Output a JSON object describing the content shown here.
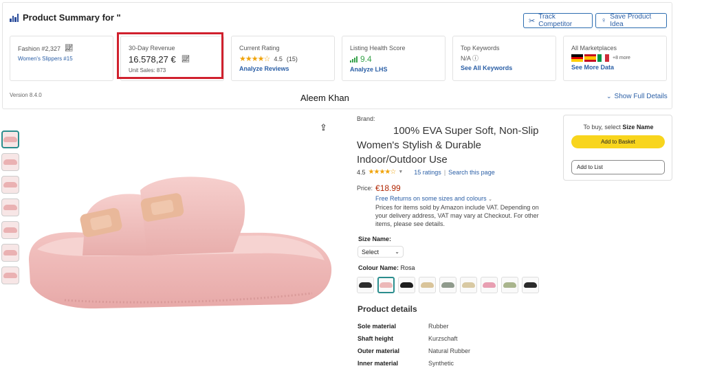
{
  "summary": {
    "title": "Product Summary for \"",
    "track_competitor": "Track Competitor",
    "save_product_idea": "Save Product Idea",
    "version": "Version 8.4.0",
    "watermark": "Aleem Khan",
    "show_full_details": "Show Full Details",
    "cards": {
      "rank": {
        "label": "Fashion #2,327",
        "sub": "Women's Slippers #15"
      },
      "revenue": {
        "label": "30-Day Revenue",
        "value": "16.578,27 €",
        "unit_sales": "Unit Sales:  873"
      },
      "rating": {
        "label": "Current Rating",
        "value": "4.5",
        "count": "(15)",
        "link": "Analyze Reviews",
        "stars": 4.5
      },
      "lhs": {
        "label": "Listing Health Score",
        "value": "9.4",
        "link": "Analyze LHS"
      },
      "keywords": {
        "label": "Top Keywords",
        "value": "N/A",
        "link": "See All Keywords"
      },
      "marketplaces": {
        "label": "All Marketplaces",
        "more": "+8 more",
        "link": "See More Data"
      }
    },
    "highlight_color": "#d0202d"
  },
  "product": {
    "brand_label": "Brand:",
    "title": "100% EVA Super Soft, Non-Slip Women's Stylish & Durable Indoor/Outdoor Use",
    "rating_value": "4.5",
    "rating_stars": 4.5,
    "ratings_count": "15 ratings",
    "search_page": "Search this page",
    "price_label": "Price:",
    "price": "€18.99",
    "free_returns": "Free Returns on some sizes and colours",
    "vat_note": "Prices for items sold by Amazon include VAT. Depending on your delivery address, VAT may vary at Checkout. For other items, please see details.",
    "size_label": "Size Name:",
    "size_value": "Select",
    "colour_label": "Colour Name:",
    "colour_value": "Rosa",
    "swatch_colors": [
      "#2d2d2d",
      "#ecb8b8",
      "#1e1e1e",
      "#d9c49a",
      "#8f9a8c",
      "#d8c9a3",
      "#e89fb2",
      "#a9b58d",
      "#2a2a2a"
    ],
    "details_title": "Product details",
    "details": [
      {
        "key": "Sole material",
        "value": "Rubber"
      },
      {
        "key": "Shaft height",
        "value": "Kurzschaft"
      },
      {
        "key": "Outer material",
        "value": "Natural Rubber"
      },
      {
        "key": "Inner material",
        "value": "Synthetic"
      }
    ]
  },
  "buybox": {
    "note_prefix": "To buy, select",
    "note_bold": "Size Name",
    "add_to_basket": "Add to Basket",
    "add_to_list": "Add to List"
  },
  "icons": {
    "logo": "bar-chart-icon",
    "track": "crosshair-icon",
    "save": "lightbulb-icon",
    "trend": "trend-line-icon",
    "info": "info-icon",
    "share": "share-icon",
    "chevron": "chevron-down-icon"
  }
}
